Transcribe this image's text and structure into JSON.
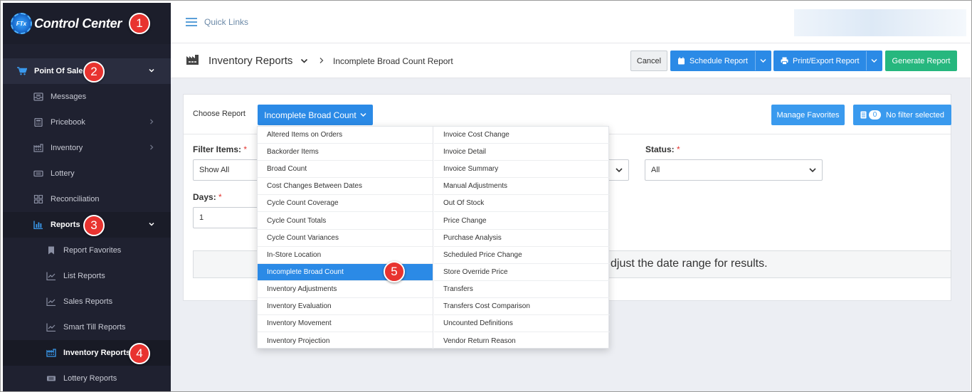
{
  "brand": {
    "name": "Control Center",
    "logo_text": "FTx"
  },
  "sidebar": {
    "items": [
      {
        "label": "Point Of Sale",
        "icon": "cart-icon",
        "level": 0
      },
      {
        "label": "Messages",
        "icon": "inbox-icon",
        "level": 1
      },
      {
        "label": "Pricebook",
        "icon": "calculator-icon",
        "level": 1
      },
      {
        "label": "Inventory",
        "icon": "warehouse-icon",
        "level": 1
      },
      {
        "label": "Lottery",
        "icon": "ticket-icon",
        "level": 1
      },
      {
        "label": "Reconciliation",
        "icon": "grid-icon",
        "level": 1
      },
      {
        "label": "Reports",
        "icon": "bar-chart-icon",
        "level": 1
      },
      {
        "label": "Report Favorites",
        "icon": "bookmark-icon",
        "level": 2
      },
      {
        "label": "List Reports",
        "icon": "line-chart-icon",
        "level": 2
      },
      {
        "label": "Sales Reports",
        "icon": "line-chart-icon",
        "level": 2
      },
      {
        "label": "Smart Till Reports",
        "icon": "line-chart-icon",
        "level": 2
      },
      {
        "label": "Inventory Reports",
        "icon": "warehouse-icon",
        "level": 2
      },
      {
        "label": "Lottery Reports",
        "icon": "ticket-icon",
        "level": 2
      }
    ]
  },
  "annotations": [
    "1",
    "2",
    "3",
    "4",
    "5"
  ],
  "topbar": {
    "quick_links": "Quick Links"
  },
  "header": {
    "title": "Inventory Reports",
    "breadcrumb": "Incomplete Broad Count Report",
    "cancel": "Cancel",
    "schedule": "Schedule Report",
    "print_export": "Print/Export Report",
    "generate": "Generate Report"
  },
  "card": {
    "choose_report_label": "Choose Report",
    "selected_report": "Incomplete Broad Count",
    "manage_favorites": "Manage Favorites",
    "filter_count": "0",
    "no_filter": "No filter selected",
    "filter_items_label": "Filter Items:",
    "filter_items_value": "Show All",
    "status_label": "Status:",
    "status_value": "All",
    "days_label": "Days:",
    "days_value": "1",
    "required_mark": "*",
    "info_text": "djust the date range for results."
  },
  "dropdown": {
    "left": [
      "Altered Items on Orders",
      "Backorder Items",
      "Broad Count",
      "Cost Changes Between Dates",
      "Cycle Count Coverage",
      "Cycle Count Totals",
      "Cycle Count Variances",
      "In-Store Location",
      "Incomplete Broad Count",
      "Inventory Adjustments",
      "Inventory Evaluation",
      "Inventory Movement",
      "Inventory Projection"
    ],
    "right": [
      "Invoice Cost Change",
      "Invoice Detail",
      "Invoice Summary",
      "Manual Adjustments",
      "Out Of Stock",
      "Price Change",
      "Purchase Analysis",
      "Scheduled Price Change",
      "Store Override Price",
      "Transfers",
      "Transfers Cost Comparison",
      "Uncounted Definitions",
      "Vendor Return Reason"
    ],
    "selected": "Incomplete Broad Count"
  },
  "colors": {
    "accent": "#2b8ae6",
    "green": "#26b77e",
    "sidebar": "#1f2130",
    "badge": "#e8332f"
  }
}
